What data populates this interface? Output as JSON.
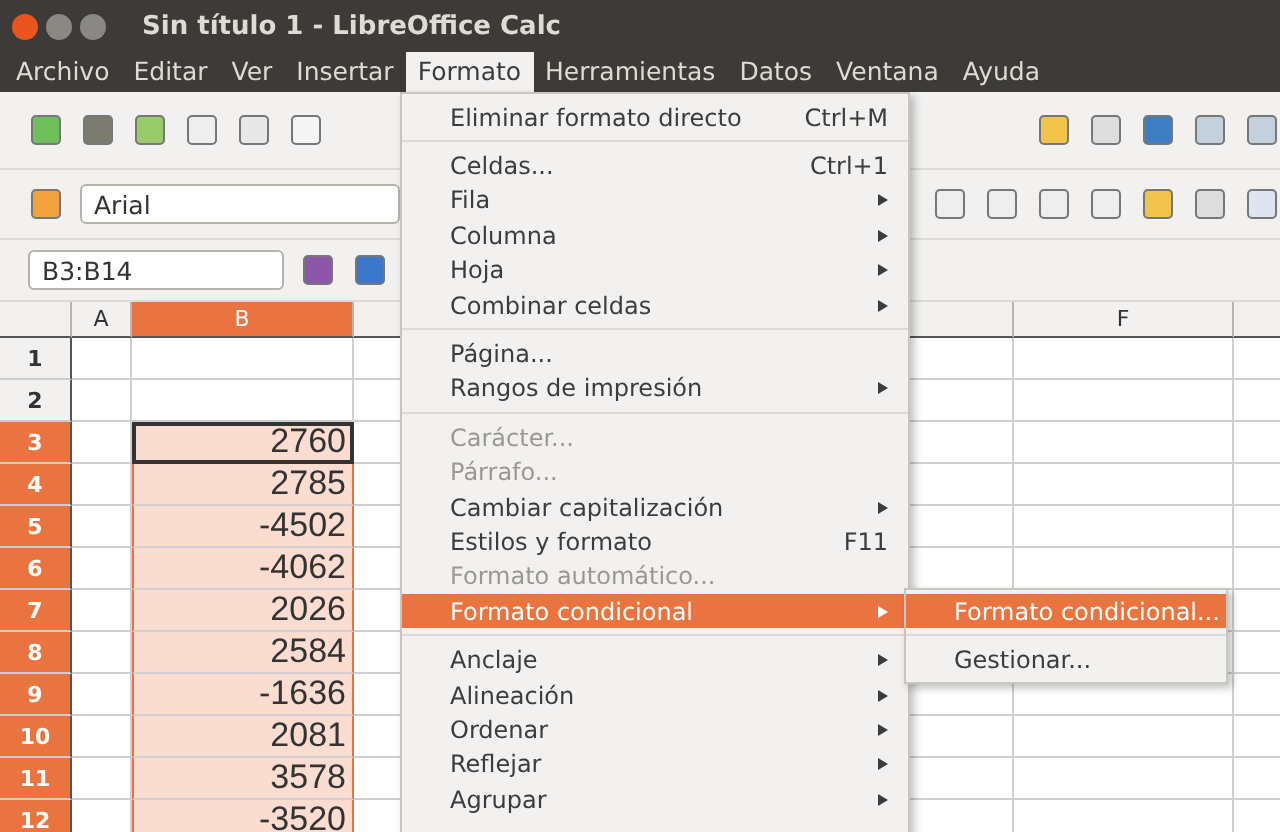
{
  "window": {
    "title": "Sin título 1 - LibreOffice Calc"
  },
  "menubar": [
    {
      "label": "Archivo",
      "selected": false
    },
    {
      "label": "Editar",
      "selected": false
    },
    {
      "label": "Ver",
      "selected": false
    },
    {
      "label": "Insertar",
      "selected": false
    },
    {
      "label": "Formato",
      "selected": true
    },
    {
      "label": "Herramientas",
      "selected": false
    },
    {
      "label": "Datos",
      "selected": false
    },
    {
      "label": "Ventana",
      "selected": false
    },
    {
      "label": "Ayuda",
      "selected": false
    }
  ],
  "font_name": {
    "value": "Arial"
  },
  "name_box": {
    "value": "B3:B14"
  },
  "sheet": {
    "columns": [
      {
        "label": "A",
        "selected": false
      },
      {
        "label": "B",
        "selected": true
      },
      {
        "selected": false
      },
      {
        "selected": false
      },
      {
        "label": "F",
        "selected": false
      }
    ],
    "rows": [
      {
        "label": "1",
        "selected": false,
        "active": false
      },
      {
        "label": "2",
        "selected": false,
        "active": false
      },
      {
        "label": "3",
        "selected": true,
        "value": "2760",
        "active": true
      },
      {
        "label": "4",
        "selected": true,
        "value": "2785",
        "active": false
      },
      {
        "label": "5",
        "selected": true,
        "value": "-4502",
        "active": false
      },
      {
        "label": "6",
        "selected": true,
        "value": "-4062",
        "active": false
      },
      {
        "label": "7",
        "selected": true,
        "value": "2026",
        "active": false
      },
      {
        "label": "8",
        "selected": true,
        "value": "2584",
        "active": false
      },
      {
        "label": "9",
        "selected": true,
        "value": "-1636",
        "active": false
      },
      {
        "label": "10",
        "selected": true,
        "value": "2081",
        "active": false
      },
      {
        "label": "11",
        "selected": true,
        "value": "3578",
        "active": false
      },
      {
        "label": "12",
        "selected": true,
        "value": "-3520",
        "active": false
      }
    ]
  },
  "menu": {
    "items": [
      {
        "kind": "item",
        "label": "Eliminar formato directo",
        "shortcut": "Ctrl+M",
        "submenu": false,
        "disabled": false,
        "selected": false
      },
      {
        "kind": "separator"
      },
      {
        "kind": "item",
        "label": "Celdas...",
        "shortcut": "Ctrl+1",
        "submenu": false,
        "disabled": false,
        "selected": false
      },
      {
        "kind": "item",
        "label": "Fila",
        "submenu": true,
        "disabled": false,
        "selected": false
      },
      {
        "kind": "item",
        "label": "Columna",
        "submenu": true,
        "disabled": false,
        "selected": false
      },
      {
        "kind": "item",
        "label": "Hoja",
        "submenu": true,
        "disabled": false,
        "selected": false
      },
      {
        "kind": "item",
        "label": "Combinar celdas",
        "submenu": true,
        "disabled": false,
        "selected": false
      },
      {
        "kind": "separator"
      },
      {
        "kind": "item",
        "label": "Página...",
        "submenu": false,
        "disabled": false,
        "selected": false
      },
      {
        "kind": "item",
        "label": "Rangos de impresión",
        "submenu": true,
        "disabled": false,
        "selected": false
      },
      {
        "kind": "separator"
      },
      {
        "kind": "item",
        "label": "Carácter...",
        "submenu": false,
        "disabled": true,
        "selected": false
      },
      {
        "kind": "item",
        "label": "Párrafo...",
        "submenu": false,
        "disabled": true,
        "selected": false
      },
      {
        "kind": "item",
        "label": "Cambiar capitalización",
        "submenu": true,
        "disabled": false,
        "selected": false
      },
      {
        "kind": "item",
        "label": "Estilos y formato",
        "shortcut": "F11",
        "submenu": false,
        "disabled": false,
        "selected": false
      },
      {
        "kind": "item",
        "label": "Formato automático...",
        "submenu": false,
        "disabled": true,
        "selected": false
      },
      {
        "kind": "item",
        "label": "Formato condicional",
        "submenu": true,
        "disabled": false,
        "selected": true
      },
      {
        "kind": "separator"
      },
      {
        "kind": "item",
        "label": "Anclaje",
        "submenu": true,
        "disabled": false,
        "selected": false
      },
      {
        "kind": "item",
        "label": "Alineación",
        "submenu": true,
        "disabled": false,
        "selected": false
      },
      {
        "kind": "item",
        "label": "Ordenar",
        "submenu": true,
        "disabled": false,
        "selected": false
      },
      {
        "kind": "item",
        "label": "Reflejar",
        "submenu": true,
        "disabled": false,
        "selected": false
      },
      {
        "kind": "item",
        "label": "Agrupar",
        "submenu": true,
        "disabled": false,
        "selected": false
      }
    ]
  },
  "submenu": {
    "items": [
      {
        "kind": "item",
        "label": "Formato condicional...",
        "selected": true
      },
      {
        "kind": "separator"
      },
      {
        "kind": "item",
        "label": "Gestionar...",
        "selected": false
      }
    ]
  }
}
